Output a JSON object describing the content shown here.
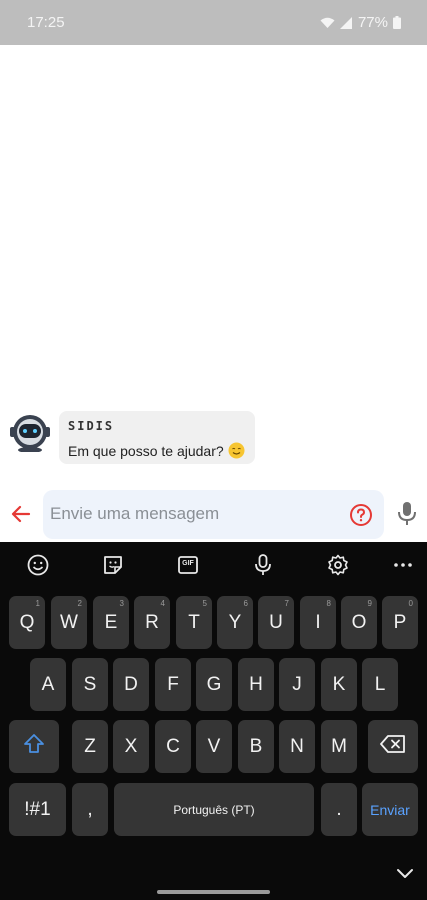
{
  "status_bar": {
    "time": "17:25",
    "battery": "77%"
  },
  "chat": {
    "bot_name": "SIDIS",
    "messages": [
      {
        "text": "Em que posso te ajudar?"
      }
    ]
  },
  "composer": {
    "placeholder": "Envie uma mensagem"
  },
  "keyboard": {
    "row1": [
      {
        "label": "Q",
        "hint": "1"
      },
      {
        "label": "W",
        "hint": "2"
      },
      {
        "label": "E",
        "hint": "3"
      },
      {
        "label": "R",
        "hint": "4"
      },
      {
        "label": "T",
        "hint": "5"
      },
      {
        "label": "Y",
        "hint": "6"
      },
      {
        "label": "U",
        "hint": "7"
      },
      {
        "label": "I",
        "hint": "8"
      },
      {
        "label": "O",
        "hint": "9"
      },
      {
        "label": "P",
        "hint": "0"
      }
    ],
    "row2": [
      "A",
      "S",
      "D",
      "F",
      "G",
      "H",
      "J",
      "K",
      "L"
    ],
    "row3": [
      "Z",
      "X",
      "C",
      "V",
      "B",
      "N",
      "M"
    ],
    "symbols_label": "!#1",
    "comma_label": ",",
    "space_label": "Português (PT)",
    "period_label": ".",
    "send_label": "Enviar",
    "gif_label": "GIF"
  },
  "colors": {
    "accent_red": "#e53935",
    "send_blue": "#5aa2ff",
    "shift_blue": "#4a90e2"
  },
  "icons": [
    "wifi-icon",
    "signal-icon",
    "battery-icon",
    "bot-avatar-icon",
    "smile-emoji-icon",
    "back-arrow-icon",
    "help-icon",
    "microphone-icon",
    "emoji-keyboard-icon",
    "sticker-icon",
    "gif-icon",
    "voice-input-icon",
    "settings-icon",
    "more-icon",
    "shift-icon",
    "backspace-icon",
    "collapse-keyboard-icon"
  ]
}
